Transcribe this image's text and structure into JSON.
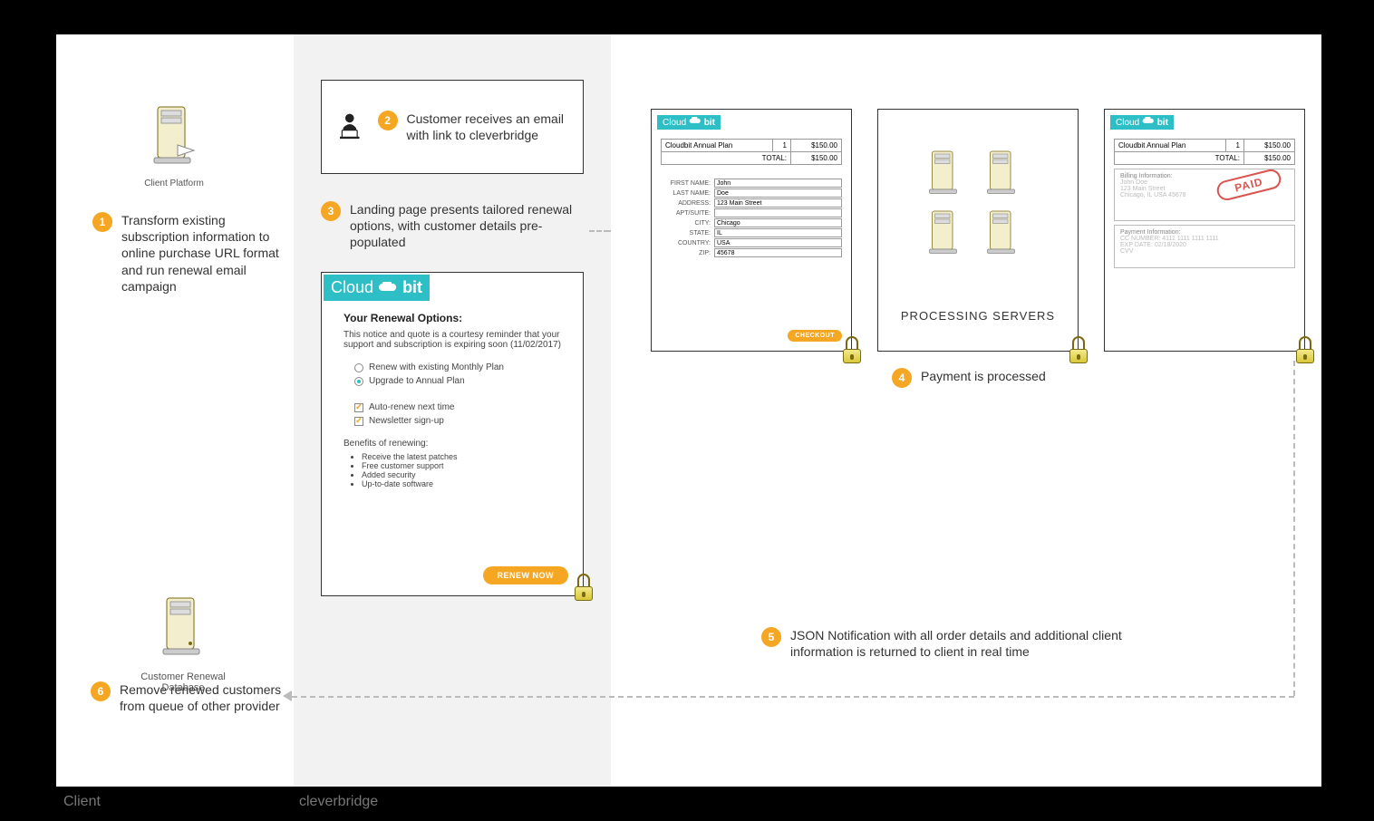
{
  "footer": {
    "client": "Client",
    "cleverbridge": "cleverbridge"
  },
  "col1": {
    "client_platform_label": "Client\nPlatform",
    "step1": {
      "num": "1",
      "text": "Transform existing subscription information to online purchase URL format and run renewal email campaign"
    },
    "renewal_db_label": "Customer Renewal Database",
    "step6": {
      "num": "6",
      "text": "Remove renewed customers from queue of other provider"
    }
  },
  "col2": {
    "step2": {
      "num": "2",
      "text": "Customer receives an email with link to cleverbridge"
    },
    "step3": {
      "num": "3",
      "text": "Landing page presents tailored renewal options, with customer details pre-populated"
    },
    "landing": {
      "brand_a": "Cloud",
      "brand_b": "bit",
      "title": "Your Renewal Options:",
      "notice": "This notice and quote is a courtesy reminder that your support and subscription is expiring soon (11/02/2017)",
      "radio1": "Renew with existing Monthly Plan",
      "radio2": "Upgrade to Annual Plan",
      "check1": "Auto-renew next time",
      "check2": "Newsletter sign-up",
      "benefits_title": "Benefits of renewing:",
      "benefits": [
        "Receive the latest patches",
        "Free customer support",
        "Added security",
        "Up-to-date software"
      ],
      "renew_btn": "RENEW NOW"
    }
  },
  "col3": {
    "brand_a": "Cloud",
    "brand_b": "bit",
    "order": {
      "item": "Cloudbit Annual Plan",
      "qty": "1",
      "price": "$150.00",
      "total_label": "TOTAL:",
      "total": "$150.00"
    },
    "form": {
      "first_name_l": "FIRST NAME:",
      "first_name": "John",
      "last_name_l": "LAST NAME:",
      "last_name": "Doe",
      "address_l": "ADDRESS:",
      "address": "123 Main Street",
      "apt_l": "APT/SUITE:",
      "apt": "",
      "city_l": "CITY:",
      "city": "Chicago",
      "state_l": "STATE:",
      "state": "IL",
      "country_l": "COUNTRY:",
      "country": "USA",
      "zip_l": "ZIP:",
      "zip": "45678"
    },
    "checkout_btn": "CHECKOUT",
    "processing_label": "PROCESSING SERVERS",
    "billing": {
      "title": "Billing Information:",
      "name": "John Doe",
      "street": "123 Main Street",
      "citystate": "Chicago, IL USA 45678"
    },
    "payment": {
      "title": "Payment Information:",
      "cc": "CC NUMBER: 4111 1111 1111 1111",
      "exp": "EXP DATE: 02/18/2020",
      "cvv": "CVV"
    },
    "paid": "PAID",
    "step4": {
      "num": "4",
      "text": "Payment is processed"
    },
    "step5": {
      "num": "5",
      "text": "JSON Notification with all order details and additional client information is returned to client in real time"
    }
  }
}
